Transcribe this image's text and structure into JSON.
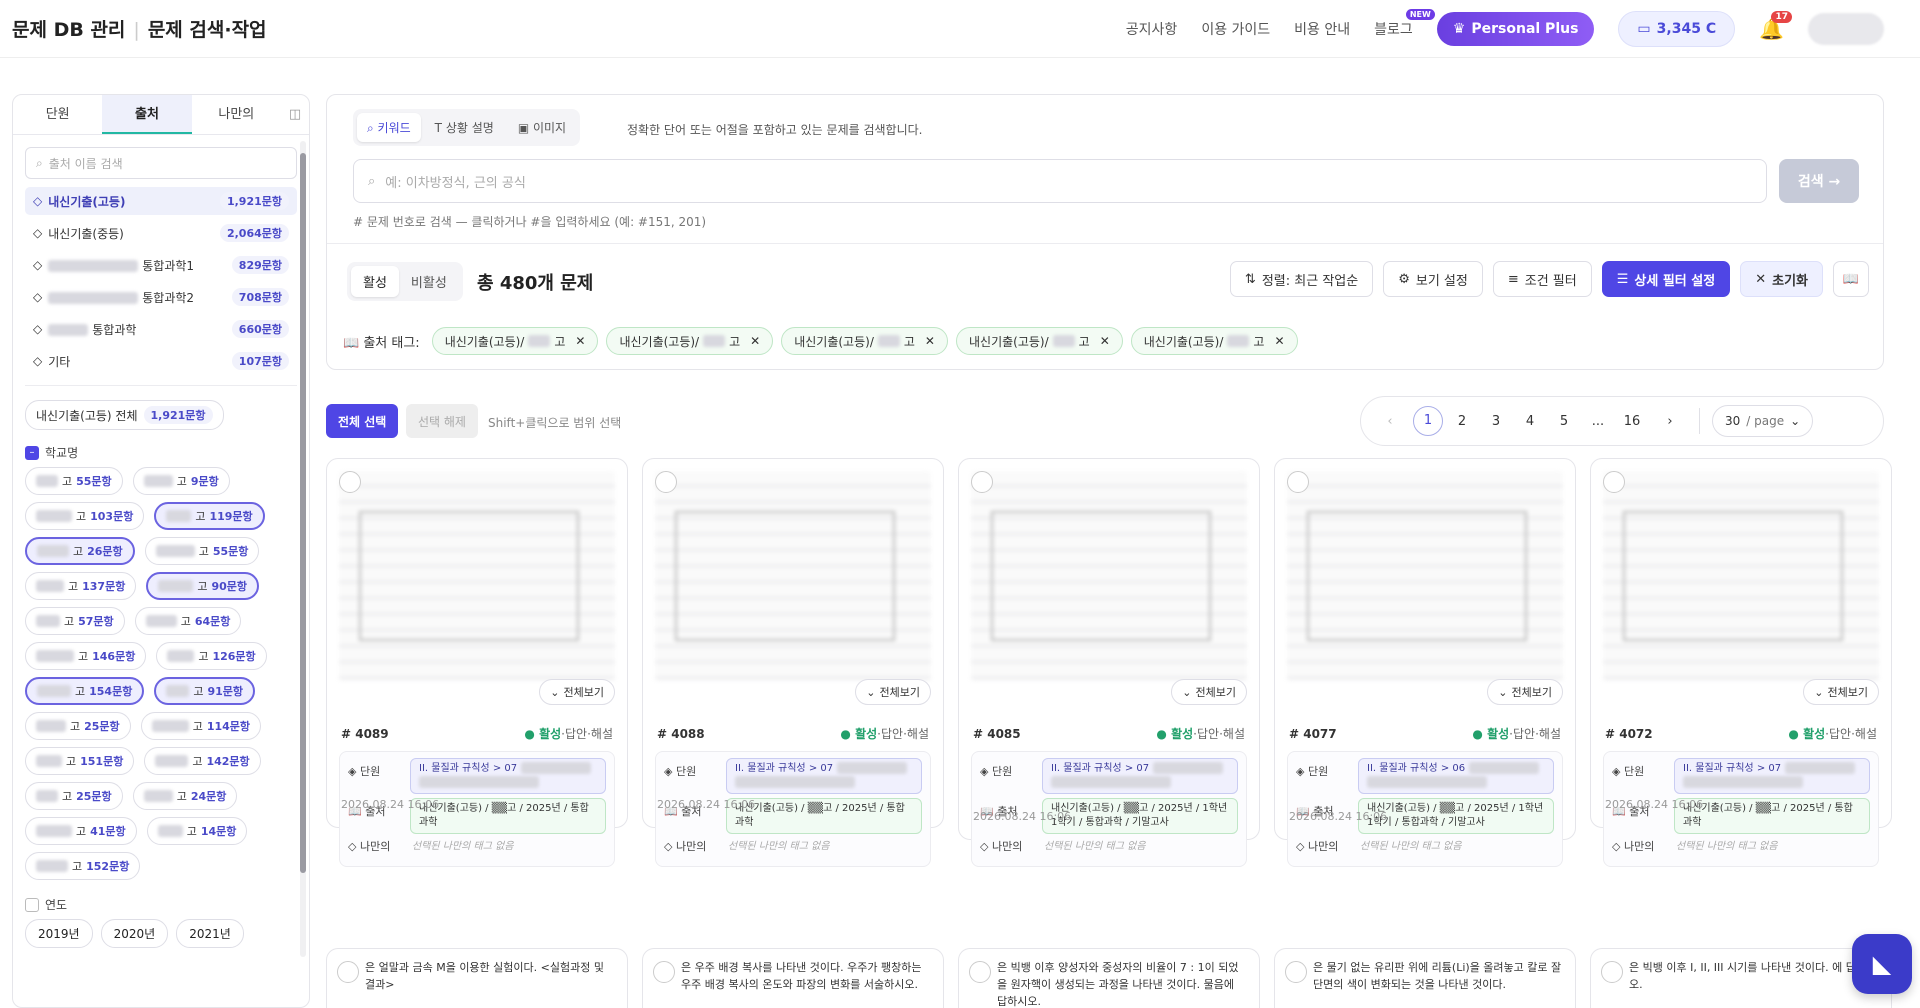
{
  "header": {
    "brand": "문제 DB 관리",
    "page": "문제 검색·작업",
    "nav": [
      "공지사항",
      "이용 가이드",
      "비용 안내",
      "블로그"
    ],
    "new_badge": "NEW",
    "plan": "Personal Plus",
    "credit": "3,345 C",
    "notif_count": "17"
  },
  "sidebar": {
    "tabs": [
      "단원",
      "출처",
      "나만의"
    ],
    "search_placeholder": "출처 이름 검색",
    "sources": [
      {
        "name": "내신기출(고등)",
        "count": "1,921문항",
        "active": true
      },
      {
        "name": "내신기출(중등)",
        "count": "2,064문항"
      },
      {
        "name": "통합과학1",
        "count": "829문항",
        "blurred": true
      },
      {
        "name": "통합과학2",
        "count": "708문항",
        "blurred": true
      },
      {
        "name": "통합과학",
        "count": "660문항",
        "blurred": true
      },
      {
        "name": "기타",
        "count": "107문항"
      }
    ],
    "all_label": "내신기출(고등) 전체",
    "all_count": "1,921문항",
    "school_group": "학교명",
    "school_suffix": "고",
    "schools": [
      {
        "c": "55문항"
      },
      {
        "c": "9문항"
      },
      {
        "c": "103문항"
      },
      {
        "c": "119문항",
        "on": true
      },
      {
        "c": "26문항",
        "on": true
      },
      {
        "c": "55문항"
      },
      {
        "c": "137문항"
      },
      {
        "c": "90문항",
        "on": true
      },
      {
        "c": "57문항"
      },
      {
        "c": "64문항"
      },
      {
        "c": "146문항"
      },
      {
        "c": "126문항"
      },
      {
        "c": "154문항",
        "on": true
      },
      {
        "c": "91문항",
        "on": true
      },
      {
        "c": "25문항"
      },
      {
        "c": "114문항"
      },
      {
        "c": "151문항"
      },
      {
        "c": "142문항"
      },
      {
        "c": "25문항"
      },
      {
        "c": "24문항"
      },
      {
        "c": "41문항"
      },
      {
        "c": "14문항"
      },
      {
        "c": "152문항"
      }
    ],
    "year_group": "연도",
    "years": [
      "2019년",
      "2020년",
      "2021년"
    ]
  },
  "search": {
    "types": [
      "키워드",
      "상황 설명",
      "이미지"
    ],
    "hint": "정확한 단어 또는 어절을 포함하고 있는 문제를 검색합니다.",
    "placeholder": "예: 이차방정식, 근의 공식",
    "button": "검색 →",
    "number_hint": "# 문제 번호로 검색 — 클릭하거나 #을 입력하세요 (예: #151, 201)"
  },
  "toolbar": {
    "active": "활성",
    "inactive": "비활성",
    "total": "총 480개 문제",
    "sort": "정렬: 최근 작업순",
    "view": "보기 설정",
    "filter": "조건 필터",
    "detail_filter": "상세 필터 설정",
    "reset": "초기화"
  },
  "tags": {
    "label": "출처 태그:",
    "items": [
      "내신기출(고등)/",
      "내신기출(고등)/",
      "내신기출(고등)/",
      "내신기출(고등)/",
      "내신기출(고등)/"
    ],
    "suffix": "고"
  },
  "list": {
    "select_all": "전체 선택",
    "deselect": "선택 해제",
    "shift_hint": "Shift+클릭으로 범위 선택",
    "pages": [
      "1",
      "2",
      "3",
      "4",
      "5",
      "...",
      "16"
    ],
    "page_size": "30",
    "page_unit": "/ page"
  },
  "cards": [
    {
      "id": "# 4089",
      "unit": "II. 물질과 규칙성 > 07",
      "source": "내신기출(고등) / ▒▒고 / 2025년 / 통합과학",
      "date": "2026.08.24 16:06"
    },
    {
      "id": "# 4088",
      "unit": "II. 물질과 규칙성 > 07",
      "source": "내신기출(고등) / ▒▒고 / 2025년 / 통합과학",
      "date": "2026.08.24 16:06"
    },
    {
      "id": "# 4085",
      "unit": "II. 물질과 규칙성 > 07",
      "source": "내신기출(고등) / ▒▒고 / 2025년 / 1학년 1학기 / 통합과학 / 기말고사",
      "date": "2026.08.24 16:06"
    },
    {
      "id": "# 4077",
      "unit": "II. 물질과 규칙성 > 06",
      "source": "내신기출(고등) / ▒▒고 / 2025년 / 1학년 1학기 / 통합과학 / 기말고사",
      "date": "2026.08.24 16:06"
    },
    {
      "id": "# 4072",
      "unit": "II. 물질과 규칙성 > 07",
      "source": "내신기출(고등) / ▒▒고 / 2025년 / 통합과학",
      "date": "2026.08.24 16:06"
    }
  ],
  "card_labels": {
    "full_view": "전체보기",
    "status": "● 활성",
    "answer": "답안",
    "solution": "해설",
    "unit": "단원",
    "source": "출처",
    "mine": "나만의",
    "mine_empty": "선택된 나만의 태그 없음"
  },
  "next_cards": [
    "은 얼말과 금속 M을 이용한 실험이다. <실험과정 및 결과>",
    "은 우주 배경 복사를 나타낸 것이다. 우주가 팽창하는 우주 배경 복사의 온도와 파장의 변화를 서술하시오.",
    "은 빅뱅 이후 양성자와 중성자의 비율이 7 : 1이 되었을 원자핵이 생성되는 과정을 나타낸 것이다. 물음에 답하시오.",
    "은 물기 없는 유리판 위에 리튬(Li)을 올려놓고 칼로 잘 단면의 색이 변화되는 것을 나타낸 것이다.",
    "은 빅뱅 이후 I, II, III 시기를 나타낸 것이다. 에 답하시오."
  ],
  "colors": {
    "primary": "#4f46e5",
    "active_green": "#22a06b",
    "plan": "#7c4ae8"
  }
}
